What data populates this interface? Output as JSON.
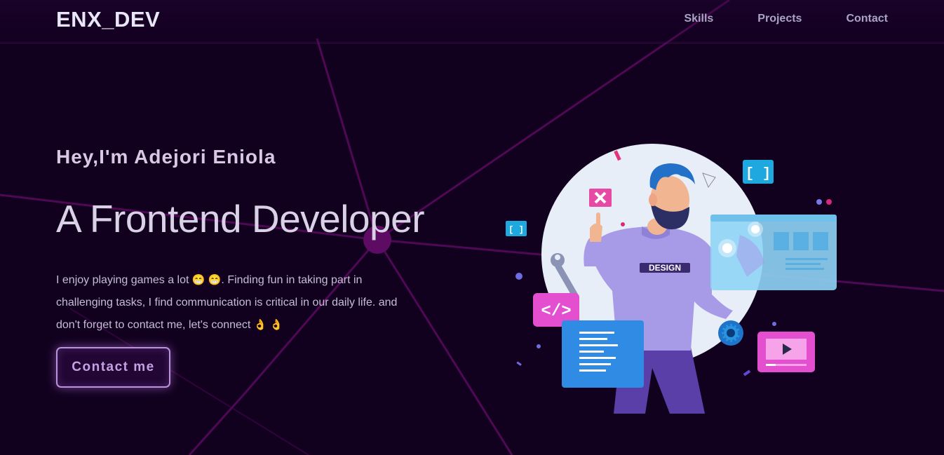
{
  "header": {
    "logo": "ENX_DEV",
    "nav": [
      "Skills",
      "Projects",
      "Contact"
    ]
  },
  "hero": {
    "greeting": "Hey,I'm Adejori Eniola",
    "headline": "A Frontend Developer",
    "bio_part1": "I enjoy playing games a lot ",
    "emoji_grin": "😁 😁",
    "bio_part2": ". Finding fun in taking part in challenging tasks, I find communication is critical in our daily life. and don't forget to contact me, let's connect ",
    "emoji_ok": "👌 👌",
    "cta_label": "Contact me"
  },
  "illustration": {
    "shirt_text": "DESIGN",
    "code_icon_text": "</>",
    "bracket_text": "[ ]"
  },
  "colors": {
    "background": "#12001f",
    "accent": "#b993dc",
    "network_line": "#5a0a5e"
  }
}
